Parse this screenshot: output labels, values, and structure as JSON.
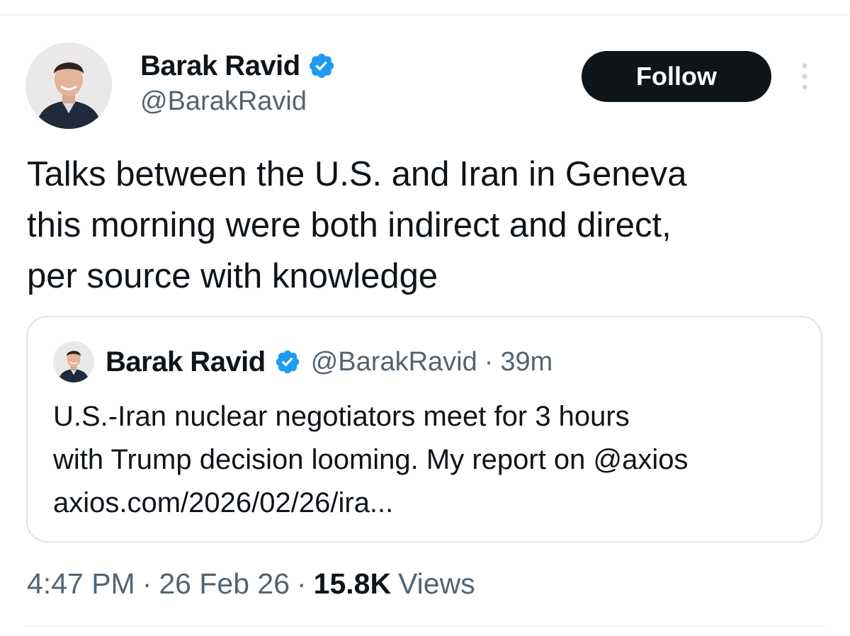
{
  "author": {
    "name": "Barak Ravid",
    "handle": "@BarakRavid",
    "verified_icon": "verified-badge-icon",
    "accent_color": "#1d9bf0"
  },
  "actions": {
    "follow_label": "Follow",
    "more_icon": "more-vertical-icon"
  },
  "tweet": {
    "line1": "Talks between the U.S. and Iran in Geneva",
    "line2": "this morning were both indirect and direct,",
    "line3": "per source with knowledge"
  },
  "quoted_tweet": {
    "name": "Barak Ravid",
    "handle": "@BarakRavid",
    "separator": "·",
    "time": "39m",
    "line1": "U.S.-Iran nuclear negotiators meet for 3 hours",
    "line2": "with Trump decision looming. My report on @axios",
    "link": "axios.com/2026/02/26/ira..."
  },
  "meta": {
    "time": "4:47 PM",
    "separator": "·",
    "date": "26 Feb 26",
    "views_count": "15.8K",
    "views_label": "Views"
  }
}
